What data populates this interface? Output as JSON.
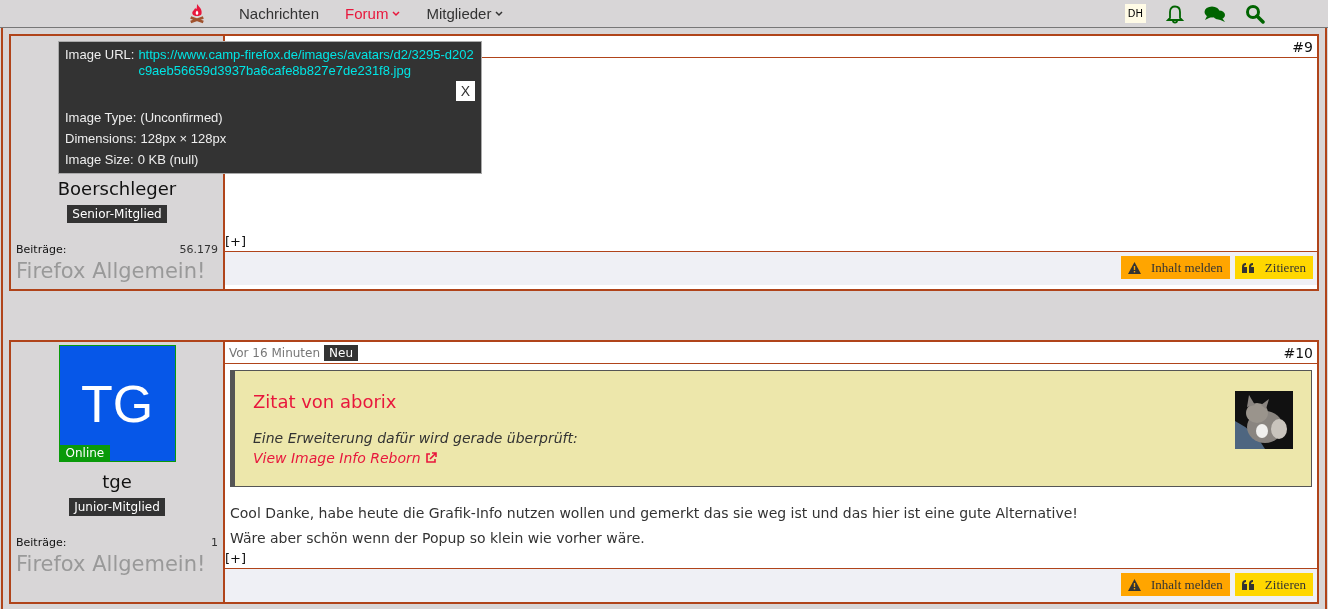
{
  "nav": {
    "items": [
      {
        "label": "Nachrichten",
        "selected": false,
        "dropdown": false
      },
      {
        "label": "Forum",
        "selected": true,
        "dropdown": true
      },
      {
        "label": "Mitglieder",
        "selected": false,
        "dropdown": true
      }
    ],
    "user_initials": "DH"
  },
  "posts": [
    {
      "author": "Boerschleger",
      "rank": "Senior-Mitglied",
      "posts_label": "Beiträge:",
      "posts_count": "56.179",
      "signature": "Firefox Allgemein!",
      "number": "#9",
      "expand": "[+]",
      "report": "Inhalt melden",
      "quote_button": "Zitieren"
    },
    {
      "author": "tge",
      "online": true,
      "online_label": "Online",
      "avatar": "TG",
      "rank": "Junior-Mitglied",
      "posts_label": "Beiträge:",
      "posts_count": "1",
      "signature": "Firefox Allgemein!",
      "time": "Vor 16 Minuten",
      "new_badge": "Neu",
      "number": "#10",
      "quote": {
        "title": "Zitat von aborix",
        "text": "Eine Erweiterung dafür wird gerade überprüft:",
        "link": "View Image Info Reborn"
      },
      "text": [
        "Cool Danke, habe heute die Grafik-Info nutzen wollen und gemerkt das sie weg ist und das hier ist eine gute Alternative!",
        "Wäre aber schön wenn der Popup so klein wie vorher wäre."
      ],
      "expand": "[+]",
      "report": "Inhalt melden",
      "quote_button": "Zitieren"
    }
  ],
  "image_popup": {
    "rows": [
      {
        "label": "Image URL:",
        "value": "https://www.camp-firefox.de/images/avatars/d2/3295-d202c9aeb56659d3937ba6cafe8b827e7de231f8.jpg",
        "kind": "link"
      },
      {
        "label": "Image Type:",
        "value": "(Unconfirmed)",
        "kind": "text"
      },
      {
        "label": "Dimensions:",
        "value": "128px × 128px",
        "kind": "text"
      },
      {
        "label": "Image Size:",
        "value": "0 KB (null)",
        "kind": "text"
      }
    ],
    "close": "X"
  }
}
